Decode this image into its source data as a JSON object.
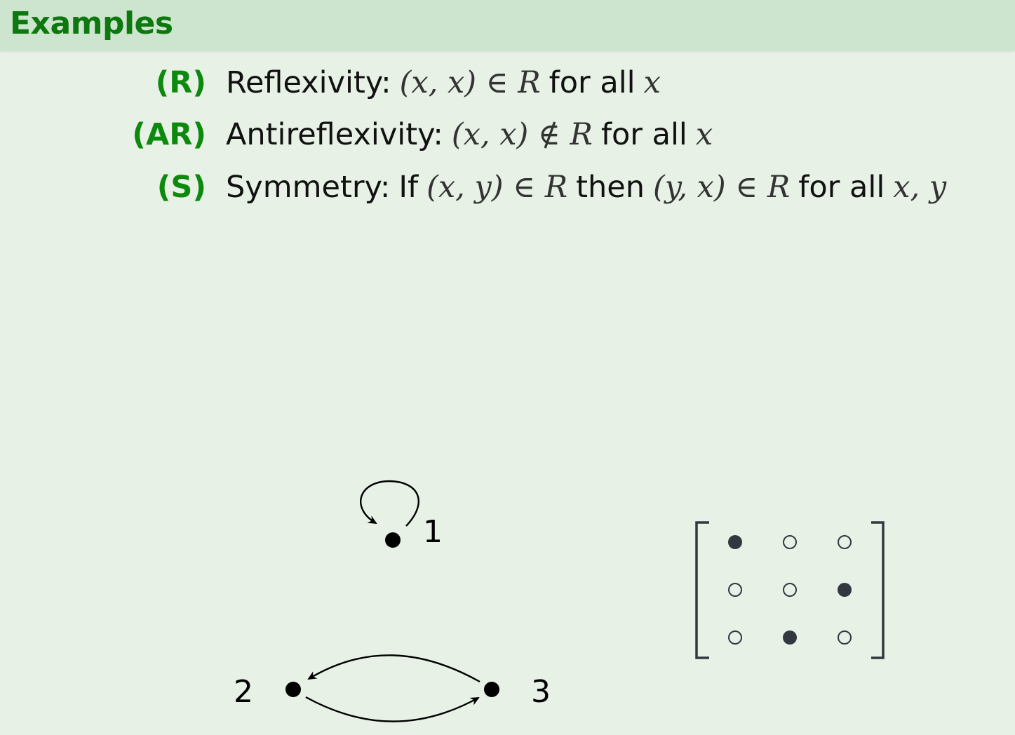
{
  "header": {
    "title": "Examples"
  },
  "definitions": [
    {
      "label": "(R)",
      "name": "Reflexivity:",
      "formula": "(x, x) ∈ R",
      "suffix": "for all",
      "vars": "x"
    },
    {
      "label": "(AR)",
      "name": "Antireflexivity:",
      "formula": "(x, x) ∉ R",
      "suffix": "for all",
      "vars": "x"
    },
    {
      "label": "(S)",
      "name": "Symmetry:",
      "prefix": "If",
      "formula": "(x, y) ∈ R",
      "middle": "then",
      "formula2": "(y, x) ∈ R",
      "suffix": "for all",
      "vars": "x, y"
    }
  ],
  "graph": {
    "nodes": [
      {
        "id": "1",
        "label": "1"
      },
      {
        "id": "2",
        "label": "2"
      },
      {
        "id": "3",
        "label": "3"
      }
    ],
    "edges": [
      {
        "from": "1",
        "to": "1"
      },
      {
        "from": "3",
        "to": "2"
      },
      {
        "from": "2",
        "to": "3"
      }
    ]
  },
  "matrix": {
    "rows": [
      [
        1,
        0,
        0
      ],
      [
        0,
        0,
        1
      ],
      [
        0,
        1,
        0
      ]
    ],
    "filled_color": "#333840"
  },
  "colors": {
    "title": "#0d780d",
    "label": "#0d8a0d",
    "header_bg": "#cde5cf",
    "page_bg": "#e7f1e6"
  }
}
